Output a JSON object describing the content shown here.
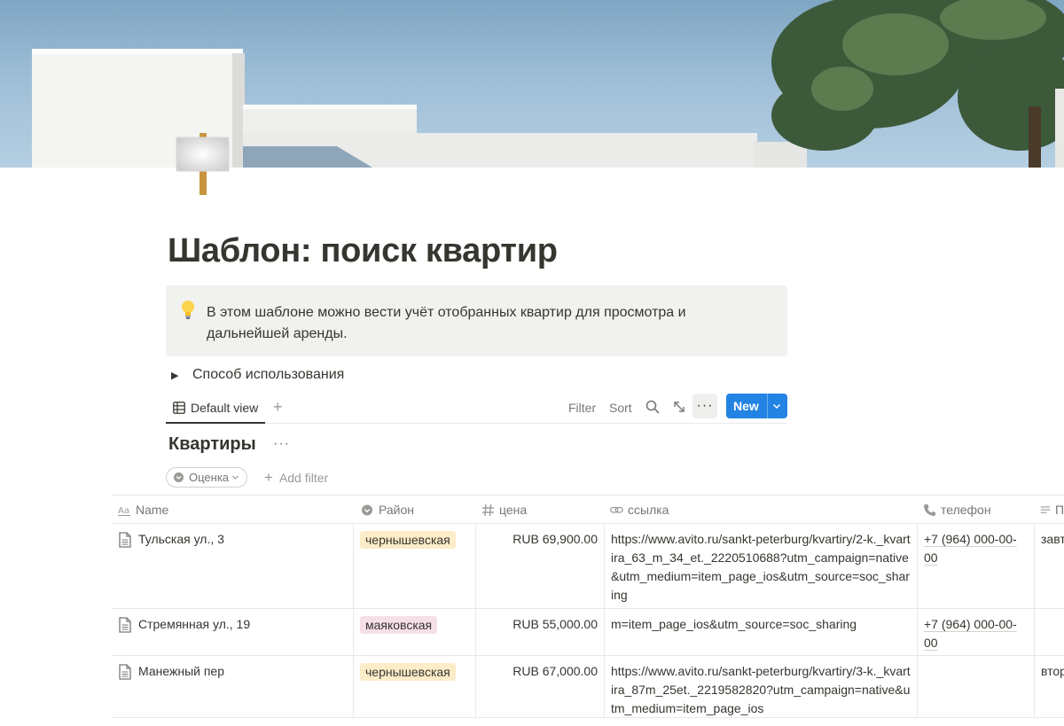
{
  "page": {
    "title": "Шаблон: поиск квартир",
    "callout": "В этом шаблоне можно вести учёт отобранных квартир для просмотра и дальнейшей аренды.",
    "toggle_label": "Способ использования"
  },
  "view": {
    "tab_label": "Default view",
    "filter_label": "Filter",
    "sort_label": "Sort",
    "new_label": "New"
  },
  "database": {
    "title": "Квартиры",
    "filter_pill": "Оценка",
    "add_filter": "Add filter",
    "columns": [
      "Name",
      "Район",
      "цена",
      "ссылка",
      "телефон",
      "П"
    ],
    "rows": [
      {
        "name": "Тульская ул., 3",
        "district": "чернышевская",
        "district_color": "#fdecc8",
        "price": "RUB 69,900.00",
        "link": "https://www.avito.ru/sankt-peterburg/kvartiry/2-k._kvartira_63_m_34_et._2220510688?utm_campaign=native&utm_medium=item_page_ios&utm_source=soc_sharing",
        "phone": "+7 (964) 000-00-00",
        "note": "завт"
      },
      {
        "name": "Стремянная ул., 19",
        "district": "маяковская",
        "district_color": "#f5e0e9",
        "price": "RUB 55,000.00",
        "link": "m=item_page_ios&utm_source=soc_sharing",
        "phone": "+7 (964) 000-00-00",
        "note": ""
      },
      {
        "name": "Манежный пер",
        "district": "чернышевская",
        "district_color": "#fdecc8",
        "price": "RUB 67,000.00",
        "link": "https://www.avito.ru/sankt-peterburg/kvartiry/3-k._kvartira_87m_25et._2219582820?utm_campaign=native&utm_medium=item_page_ios",
        "phone": "",
        "note": "втор"
      }
    ]
  }
}
